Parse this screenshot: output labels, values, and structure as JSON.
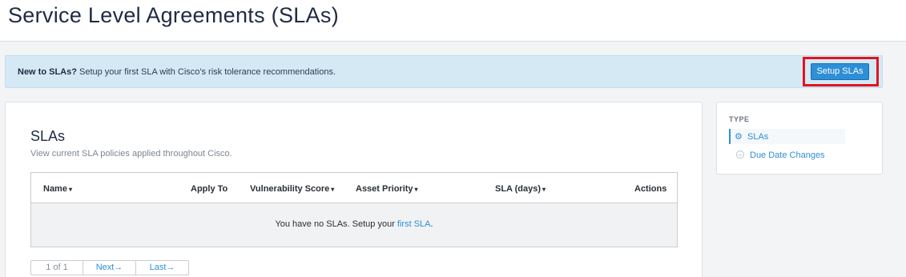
{
  "header": {
    "title": "Service Level Agreements (SLAs)"
  },
  "banner": {
    "bold_text": "New to SLAs?",
    "text": " Setup your first SLA with Cisco's risk tolerance recommendations.",
    "button_label": "Setup SLAs"
  },
  "main": {
    "title": "SLAs",
    "subtitle": "View current SLA policies applied throughout Cisco.",
    "table": {
      "columns": [
        {
          "label": "Name",
          "sortable": true
        },
        {
          "label": "Apply To",
          "sortable": false
        },
        {
          "label": "Vulnerability Score",
          "sortable": true
        },
        {
          "label": "Asset Priority",
          "sortable": true
        },
        {
          "label": "SLA (days)",
          "sortable": true
        },
        {
          "label": "Actions",
          "sortable": false
        }
      ],
      "empty_text": "You have no SLAs. Setup your ",
      "empty_link": "first SLA",
      "empty_suffix": "."
    },
    "pagination": {
      "current": "1 of 1",
      "next": "Next→",
      "last": "Last→"
    }
  },
  "sidebar": {
    "section_label": "TYPE",
    "items": [
      {
        "label": "SLAs",
        "icon": "gear-icon",
        "active": true
      },
      {
        "label": "Due Date Changes",
        "icon": "circle-icon",
        "active": false
      }
    ]
  },
  "colors": {
    "accent": "#2d8fd5",
    "banner_bg": "#d5e9f5",
    "highlight": "#e0141e"
  },
  "caret_glyph": "▾"
}
